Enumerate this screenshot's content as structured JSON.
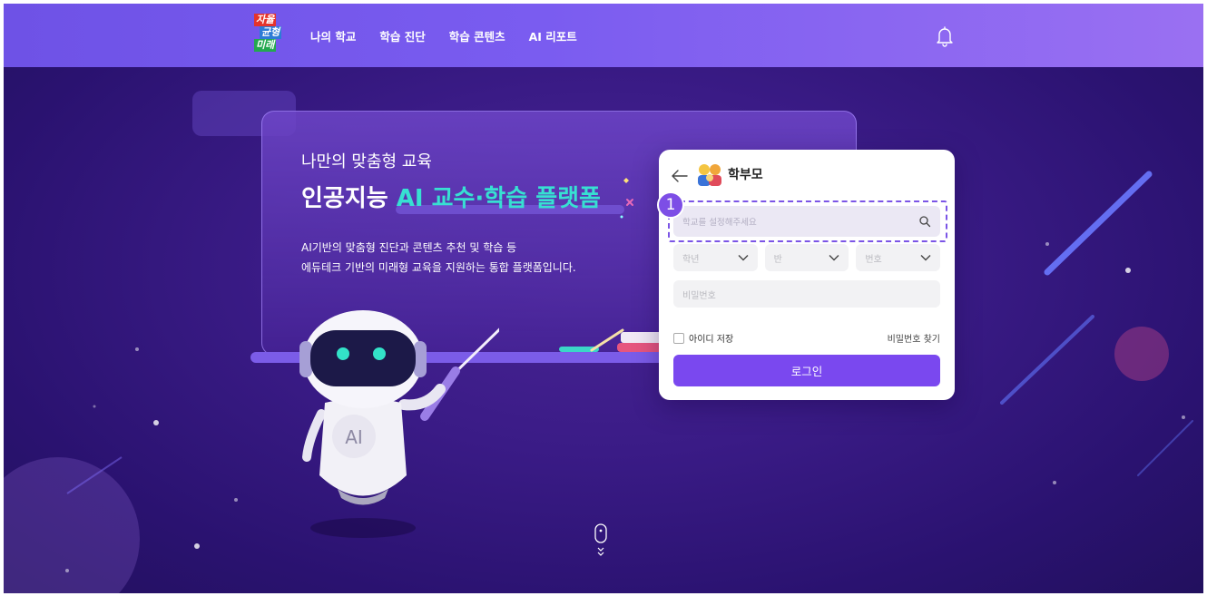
{
  "header": {
    "logo": {
      "line1": "자율",
      "line2": "균형",
      "line3": "미래"
    },
    "nav": [
      "나의 학교",
      "학습 진단",
      "학습 콘텐츠",
      "AI 리포트"
    ]
  },
  "hero": {
    "subtitle": "나만의 맞춤형 교육",
    "title_plain": "인공지능 ",
    "title_highlight": "AI 교수·학습 플랫폼",
    "desc_line1": "AI기반의 맞춤형 진단과 콘텐츠 추천 및 학습 등",
    "desc_line2": "에듀테크 기반의 미래형 교육을 지원하는 통합 플랫폼입니다.",
    "robot_label": "AI"
  },
  "login": {
    "role": "학부모",
    "school_placeholder": "학교를 설정해주세요",
    "annotation_number": "1",
    "grade_label": "학년",
    "class_label": "반",
    "number_label": "번호",
    "password_placeholder": "비밀번호",
    "save_id_label": "아이디 저장",
    "find_password_label": "비밀번호 찾기",
    "login_button": "로그인"
  },
  "colors": {
    "header_gradient_start": "#6e52e6",
    "header_gradient_end": "#9a70f2",
    "accent_cyan": "#37e0d2",
    "primary_button": "#7a48ef",
    "annotation_badge": "#7d4ee6"
  },
  "icons": [
    "bell-icon",
    "back-arrow-icon",
    "parent-icon",
    "search-icon",
    "chevron-down-icon",
    "mouse-scroll-icon"
  ]
}
